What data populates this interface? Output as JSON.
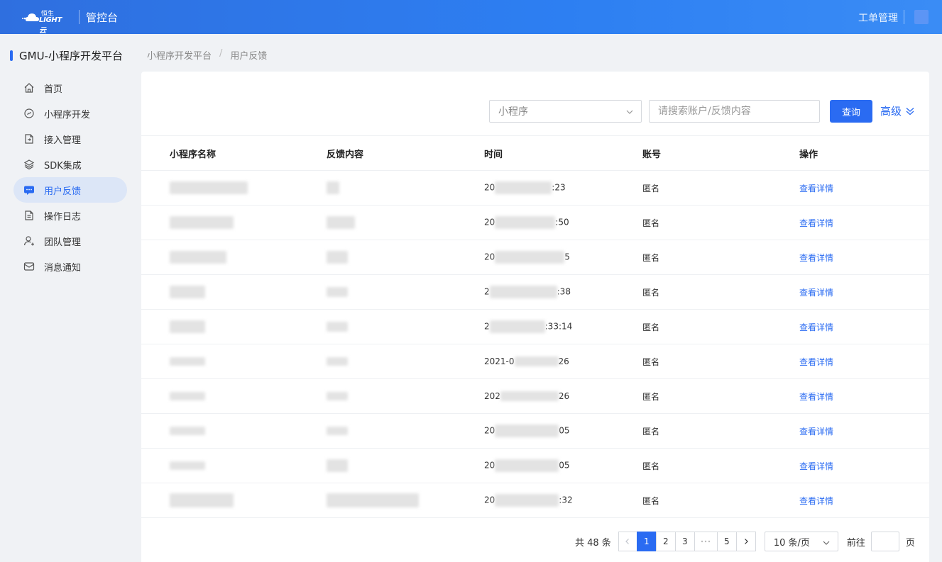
{
  "topbar": {
    "brand_top": "恒生",
    "brand_bottom": "LIGHT云",
    "console_title": "管控台",
    "ticket_link": "工单管理",
    "colors": {
      "bg_start": "#2f6fdf",
      "bg_end": "#3a8cf5"
    }
  },
  "sidebar": {
    "platform_title": "GMU-小程序开发平台",
    "items": [
      {
        "label": "首页",
        "icon": "home-icon",
        "active": false
      },
      {
        "label": "小程序开发",
        "icon": "code-circle-icon",
        "active": false
      },
      {
        "label": "接入管理",
        "icon": "document-login-icon",
        "active": false
      },
      {
        "label": "SDK集成",
        "icon": "layers-icon",
        "active": false
      },
      {
        "label": "用户反馈",
        "icon": "message-icon",
        "active": true
      },
      {
        "label": "操作日志",
        "icon": "file-text-icon",
        "active": false
      },
      {
        "label": "团队管理",
        "icon": "user-add-icon",
        "active": false
      },
      {
        "label": "消息通知",
        "icon": "mail-icon",
        "active": false
      }
    ]
  },
  "breadcrumb": {
    "parent": "小程序开发平台",
    "separator": "/",
    "current": "用户反馈"
  },
  "filters": {
    "select_placeholder": "小程序",
    "search_placeholder": "请搜索账户/反馈内容",
    "query_button": "查询",
    "advanced_link": "高级"
  },
  "table": {
    "headers": [
      "小程序名称",
      "反馈内容",
      "时间",
      "账号",
      "操作"
    ],
    "rows": [
      {
        "time_prefix": "20",
        "time_suffix": ":23",
        "account": "匿名",
        "action": "查看详情"
      },
      {
        "time_prefix": "20",
        "time_suffix": ":50",
        "account": "匿名",
        "action": "查看详情"
      },
      {
        "time_prefix": "20",
        "time_suffix": "5",
        "account": "匿名",
        "action": "查看详情"
      },
      {
        "time_prefix": "2",
        "time_suffix": ":38",
        "account": "匿名",
        "action": "查看详情"
      },
      {
        "time_prefix": "2",
        "time_suffix": ":33:14",
        "account": "匿名",
        "action": "查看详情"
      },
      {
        "time_prefix": "2021-0",
        "time_suffix": "26",
        "account": "匿名",
        "action": "查看详情"
      },
      {
        "time_prefix": "202",
        "time_suffix": "26",
        "account": "匿名",
        "action": "查看详情"
      },
      {
        "time_prefix": "20",
        "time_suffix": "05",
        "account": "匿名",
        "action": "查看详情"
      },
      {
        "time_prefix": "20",
        "time_suffix": "05",
        "account": "匿名",
        "action": "查看详情"
      },
      {
        "time_prefix": "20",
        "time_suffix": ":32",
        "account": "匿名",
        "action": "查看详情"
      }
    ]
  },
  "pagination": {
    "total": "共 48 条",
    "pages": [
      "1",
      "2",
      "3",
      "5"
    ],
    "current_page": "1",
    "page_size": "10 条/页",
    "goto_label": "前往",
    "page_unit": "页"
  }
}
